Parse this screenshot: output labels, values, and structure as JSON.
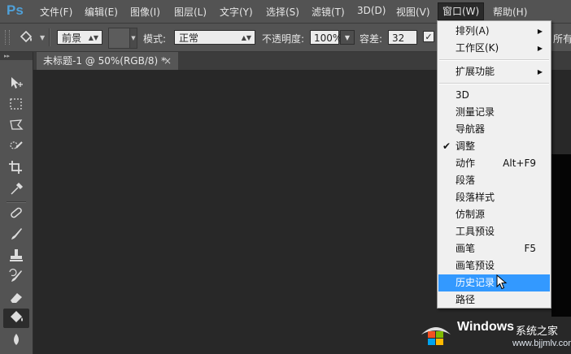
{
  "app": {
    "logo": "Ps"
  },
  "menubar": {
    "items": [
      {
        "label": "文件(F)"
      },
      {
        "label": "编辑(E)"
      },
      {
        "label": "图像(I)"
      },
      {
        "label": "图层(L)"
      },
      {
        "label": "文字(Y)"
      },
      {
        "label": "选择(S)"
      },
      {
        "label": "滤镜(T)"
      },
      {
        "label": "3D(D)"
      },
      {
        "label": "视图(V)"
      },
      {
        "label": "窗口(W)"
      },
      {
        "label": "帮助(H)"
      }
    ],
    "active": "窗口(W)"
  },
  "options": {
    "tool_icon": "paint-bucket-icon",
    "fill_source": "前景",
    "mode_label": "模式:",
    "mode_value": "正常",
    "opacity_label": "不透明度:",
    "opacity_value": "100%",
    "tolerance_label": "容差:",
    "tolerance_value": "32",
    "all_layers_label": "所有"
  },
  "document": {
    "tab_title": "未标题-1 @ 50%(RGB/8) *",
    "close_glyph": "×"
  },
  "window_menu": {
    "items": [
      {
        "label": "排列(A)",
        "submenu": true
      },
      {
        "label": "工作区(K)",
        "submenu": true
      },
      {
        "separator": true
      },
      {
        "label": "扩展功能",
        "submenu": true
      },
      {
        "separator": true
      },
      {
        "label": "3D"
      },
      {
        "label": "测量记录"
      },
      {
        "label": "导航器"
      },
      {
        "label": "调整",
        "checked": true
      },
      {
        "label": "动作",
        "shortcut": "Alt+F9"
      },
      {
        "label": "段落"
      },
      {
        "label": "段落样式"
      },
      {
        "label": "仿制源"
      },
      {
        "label": "工具预设"
      },
      {
        "label": "画笔",
        "shortcut": "F5"
      },
      {
        "label": "画笔预设"
      },
      {
        "label": "历史记录",
        "highlighted": true
      },
      {
        "label": "路径"
      }
    ]
  },
  "watermark": {
    "brand": "Windows",
    "site": "系统之家",
    "url": "www.bjjmlv.com"
  },
  "colors": {
    "chrome": "#535353",
    "workspace": "#282828",
    "menu_highlight": "#3399ff",
    "ps_logo": "#4fa0d8"
  }
}
